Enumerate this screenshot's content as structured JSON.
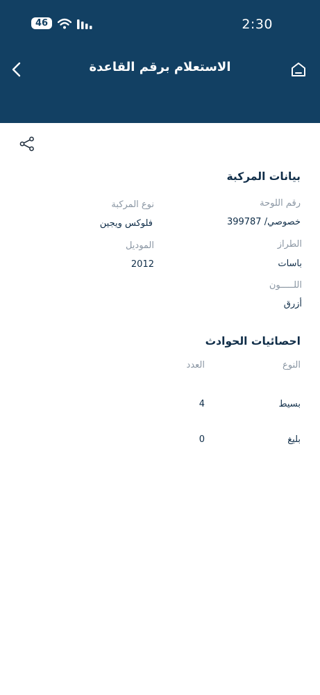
{
  "status_bar": {
    "time": "2:30",
    "battery": "46",
    "wifi_icon": "wifi-icon",
    "signal_icon": "signal-icon"
  },
  "header": {
    "title": "الاستعلام برقم القاعدة",
    "back_icon": "chevron-left-icon",
    "home_icon": "home-icon",
    "color": "#124063"
  },
  "share_icon": "share-icon",
  "vehicle": {
    "section_title": "بيانات المركبة",
    "plate_label": "رقم اللوحة",
    "plate_value": "خصوصي/ 399787",
    "type_label": "نوع المركبة",
    "type_value": "فلوكس ويجين",
    "model_label": "الطراز",
    "model_value": "باسات",
    "year_label": "الموديل",
    "year_value": "2012",
    "color_label": "اللـــــون",
    "color_value": "أزرق"
  },
  "accidents": {
    "section_title": "احصائيات الحوادث",
    "col_type": "النوع",
    "col_count": "العدد",
    "rows": [
      {
        "type": "بسيط",
        "count": "4"
      },
      {
        "type": "بليغ",
        "count": "0"
      }
    ]
  }
}
